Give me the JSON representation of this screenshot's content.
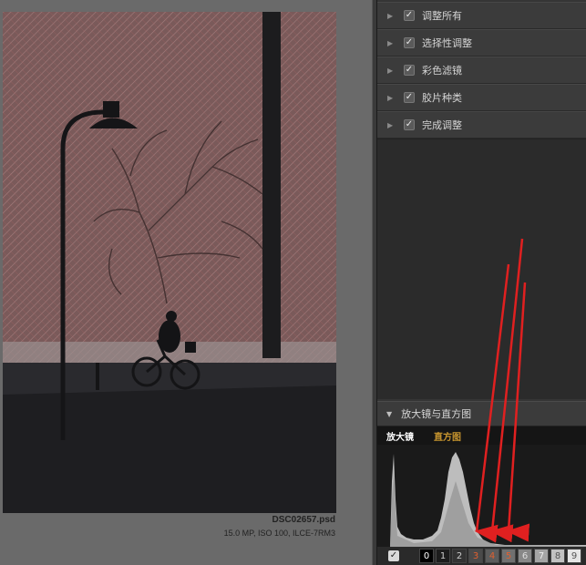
{
  "photo": {
    "file_name": "DSC02657.psd",
    "file_meta": "15.0 MP, ISO 100, ILCE-7RM3"
  },
  "adjustments": [
    {
      "label": "调整所有",
      "checked": true
    },
    {
      "label": "选择性调整",
      "checked": true
    },
    {
      "label": "彩色滤镜",
      "checked": true
    },
    {
      "label": "胶片种类",
      "checked": true
    },
    {
      "label": "完成调整",
      "checked": true
    }
  ],
  "icons": {
    "row_chevron": "▶",
    "check": "✓",
    "expanded": "▼"
  },
  "histogram_section": {
    "title": "放大镜与直方图",
    "tab_loupe": "放大镜",
    "tab_histogram": "直方图",
    "zones": [
      "0",
      "1",
      "2",
      "3",
      "4",
      "5",
      "6",
      "7",
      "8",
      "9"
    ]
  },
  "colors": {
    "accent_tab": "#c9962f",
    "arrow": "#e02020",
    "zone_highlight_text": "#e06030"
  }
}
